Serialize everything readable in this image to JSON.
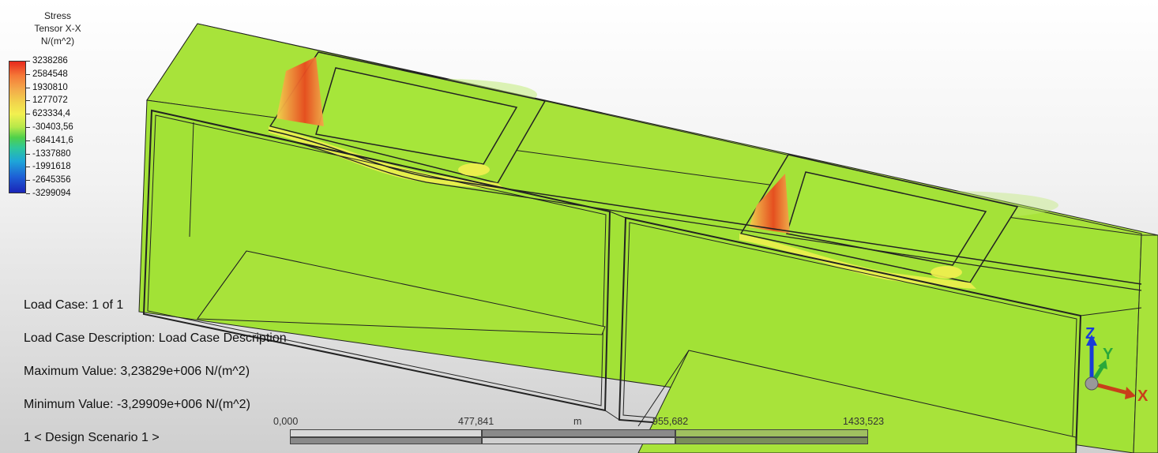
{
  "legend": {
    "title_lines": [
      "Stress",
      "Tensor X-X",
      "N/(m^2)"
    ],
    "values": [
      "3238286",
      "2584548",
      "1930810",
      "1277072",
      "623334,4",
      "-30403,56",
      "-684141,6",
      "-1337880",
      "-1991618",
      "-2645356",
      "-3299094"
    ]
  },
  "info": {
    "load_case": "Load Case:  1 of 1",
    "description": "Load Case Description:  Load Case Description",
    "max": "Maximum Value: 3,23829e+006 N/(m^2)",
    "min": "Minimum Value: -3,29909e+006 N/(m^2)",
    "scenario": "1 < Design Scenario 1 >"
  },
  "scale": {
    "ticks": [
      "0,000",
      "477,841",
      "955,682",
      "1433,523"
    ],
    "unit": "m"
  },
  "triad": {
    "x": "X",
    "y": "Y",
    "z": "Z"
  },
  "colors": {
    "model_green": "#a6e63a",
    "stress_high": "#e8281c",
    "stress_low": "#1a24b8"
  }
}
